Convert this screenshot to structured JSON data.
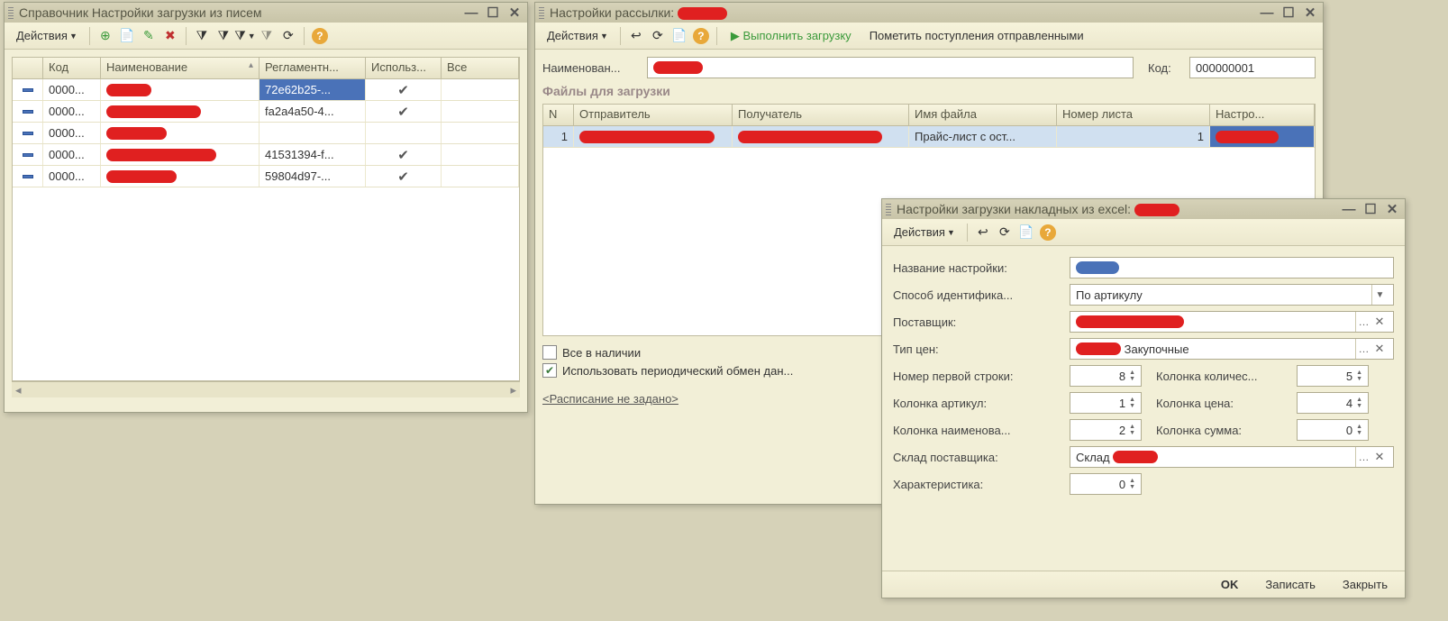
{
  "win1": {
    "title": "Справочник Настройки загрузки из писем",
    "actions_label": "Действия",
    "columns": {
      "c1": "",
      "c2": "Код",
      "c3": "Наименование",
      "c4": "Регламентн...",
      "c5": "Использ...",
      "c6": "Все"
    },
    "rows": [
      {
        "code": "0000...",
        "name_redact": true,
        "reg": "72e62b25-...",
        "used": true,
        "reg_selected": true
      },
      {
        "code": "0000...",
        "name_redact": true,
        "reg": "fa2a4a50-4...",
        "used": true
      },
      {
        "code": "0000...",
        "name_redact": true,
        "reg": "",
        "used": false
      },
      {
        "code": "0000...",
        "name_redact": true,
        "reg": "41531394-f...",
        "used": true
      },
      {
        "code": "0000...",
        "name_redact": true,
        "reg": "59804d97-...",
        "used": true
      }
    ]
  },
  "win2": {
    "title": "Настройки рассылки:",
    "actions_label": "Действия",
    "run_label": "Выполнить загрузку",
    "mark_label": "Пометить поступления отправленными",
    "name_label": "Наименован...",
    "code_label": "Код:",
    "code_value": "000000001",
    "files_title": "Файлы для загрузки",
    "columns": {
      "c1": "N",
      "c2": "Отправитель",
      "c3": "Получатель",
      "c4": "Имя файла",
      "c5": "Номер листа",
      "c6": "Настро..."
    },
    "row1": {
      "n": "1",
      "file": "Прайс-лист с ост...",
      "sheet": "1"
    },
    "chk_all": "Все в наличии",
    "chk_all_checked": false,
    "chk_periodic": "Использовать периодический обмен дан...",
    "chk_periodic_checked": true,
    "schedule_link": "<Расписание не задано>"
  },
  "win3": {
    "title": "Настройки загрузки накладных из excel:",
    "actions_label": "Действия",
    "fields": {
      "name_label": "Название настройки:",
      "ident_label": "Способ идентифика...",
      "ident_value": "По артикулу",
      "supplier_label": "Поставщик:",
      "price_label": "Тип цен:",
      "price_suffix": "Закупочные",
      "first_row_label": "Номер первой строки:",
      "first_row_value": "8",
      "qty_col_label": "Колонка количес...",
      "qty_col_value": "5",
      "art_col_label": "Колонка артикул:",
      "art_col_value": "1",
      "price_col_label": "Колонка цена:",
      "price_col_value": "4",
      "name_col_label": "Колонка наименова...",
      "name_col_value": "2",
      "sum_col_label": "Колонка сумма:",
      "sum_col_value": "0",
      "warehouse_label": "Склад поставщика:",
      "warehouse_prefix": "Склад",
      "characteristic_label": "Характеристика:",
      "characteristic_value": "0"
    },
    "footer": {
      "ok": "OK",
      "save": "Записать",
      "close": "Закрыть"
    }
  }
}
